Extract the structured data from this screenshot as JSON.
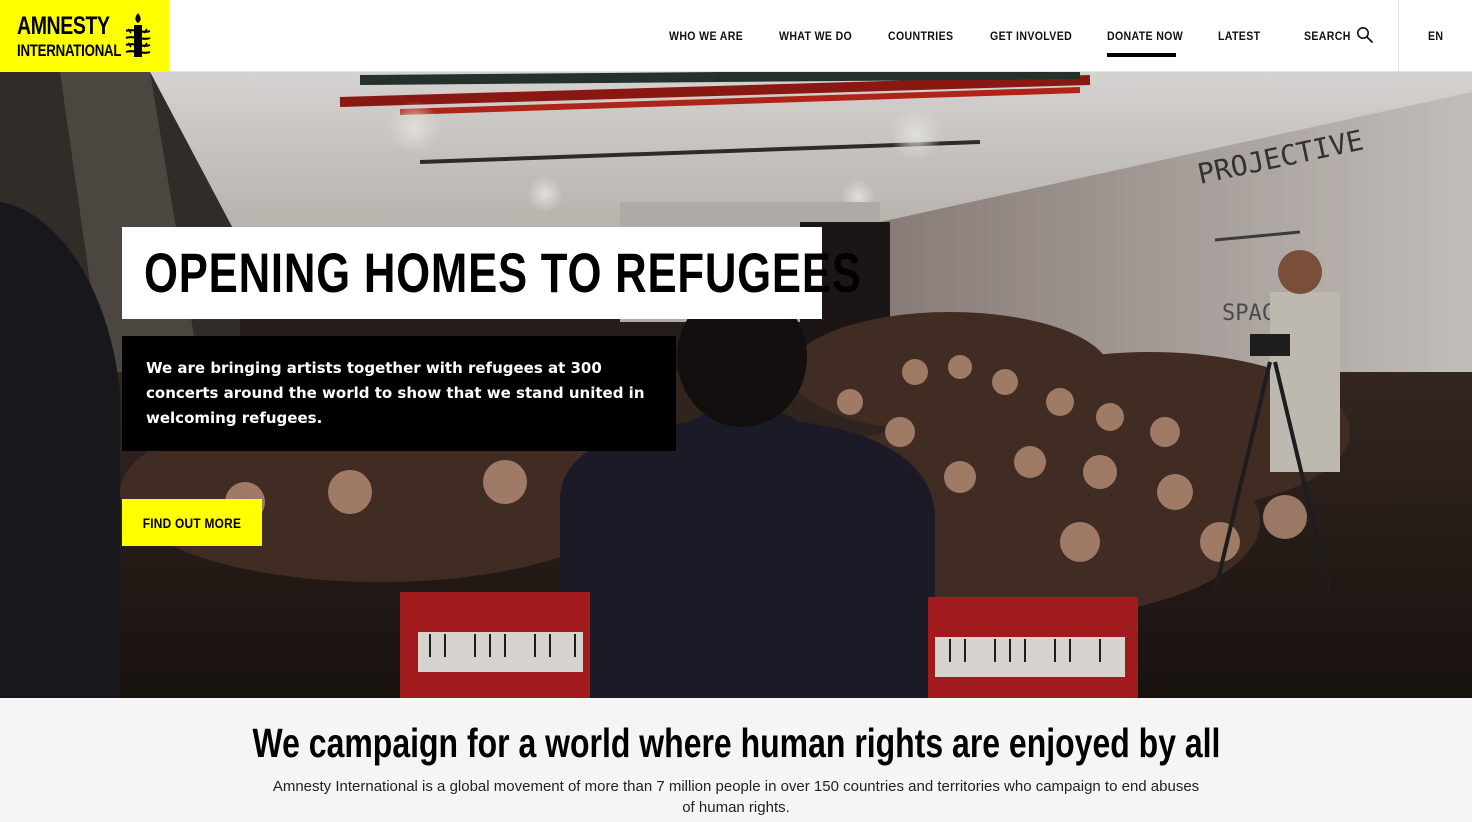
{
  "header": {
    "logo": {
      "line1": "AMNESTY",
      "line2": "INTERNATIONAL",
      "bg_color": "#ffff00",
      "icon": "candle-barbed-wire-icon"
    },
    "nav": [
      {
        "label": "WHO WE ARE",
        "active": false
      },
      {
        "label": "WHAT WE DO",
        "active": false
      },
      {
        "label": "COUNTRIES",
        "active": false
      },
      {
        "label": "GET INVOLVED",
        "active": false
      },
      {
        "label": "DONATE NOW",
        "active": true
      },
      {
        "label": "LATEST",
        "active": false
      }
    ],
    "search_label": "SEARCH",
    "search_icon": "search-icon",
    "language": "EN"
  },
  "hero": {
    "title": "OPENING HOMES TO REFUGEES",
    "description": "We are bringing artists together with refugees at 300 concerts around the world to show that we stand united in welcoming refugees.",
    "cta_label": "FIND OUT MORE",
    "cta_color": "#ffff00",
    "image": "concert-audience-photo",
    "wall_text_1": "PROJECTIVE",
    "wall_text_2": "SPACE"
  },
  "mission": {
    "heading": "We campaign for a world where human rights are enjoyed by all",
    "text": "Amnesty International is a global movement of more than 7 million people in over 150 countries and territories who campaign to end abuses of human rights."
  }
}
